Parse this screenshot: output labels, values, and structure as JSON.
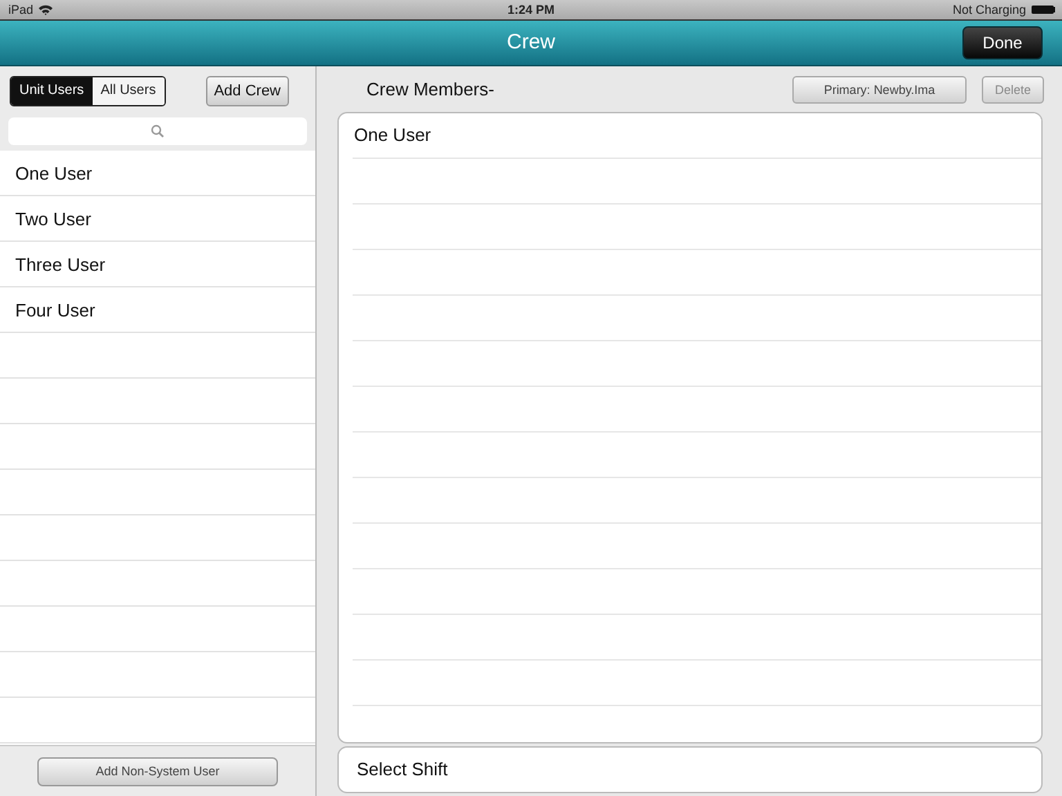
{
  "status_bar": {
    "carrier": "iPad",
    "time": "1:24 PM",
    "battery_text": "Not Charging"
  },
  "nav_bar": {
    "title": "Crew",
    "done_button": "Done"
  },
  "user_filter": [
    {
      "label": "Unit Users",
      "selected": true
    },
    {
      "label": "All Users",
      "selected": false
    }
  ],
  "add_crew_button": "Add Crew",
  "users": [
    "One User",
    "Two User",
    "Three User",
    "Four User"
  ],
  "add_non_system_button": "Add Non-System User",
  "crew_header": "Crew Members-",
  "primary_button": "Primary: Newby.Ima",
  "delete_button": {
    "label": "Delete",
    "disabled": true
  },
  "crew_members": [
    "One User"
  ],
  "shift_field": "Select Shift"
}
